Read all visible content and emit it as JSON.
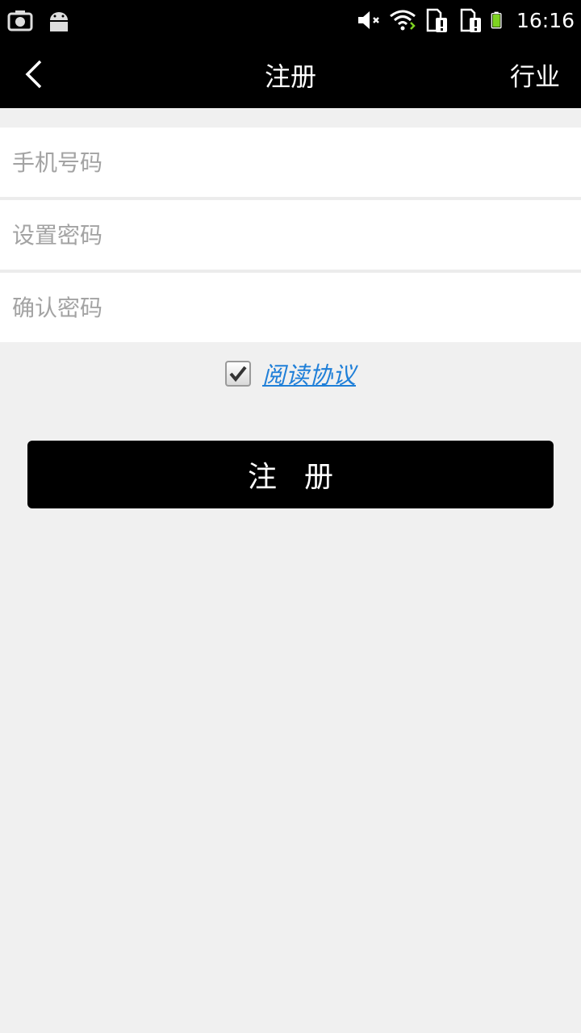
{
  "status_bar": {
    "time": "16:16",
    "icons": [
      "screenshot-icon",
      "android-icon",
      "mute-icon",
      "wifi-icon",
      "sim1-alert-icon",
      "sim2-alert-icon",
      "battery-icon"
    ]
  },
  "header": {
    "title": "注册",
    "right_action": "行业"
  },
  "form": {
    "phone_placeholder": "手机号码",
    "password_placeholder": "设置密码",
    "confirm_placeholder": "确认密码"
  },
  "agreement": {
    "checked": true,
    "link_label": "阅读协议"
  },
  "submit_label": "注册",
  "colors": {
    "bar": "#000000",
    "background": "#f0f0f0",
    "link": "#1f7fd8",
    "battery": "#7ed321"
  }
}
